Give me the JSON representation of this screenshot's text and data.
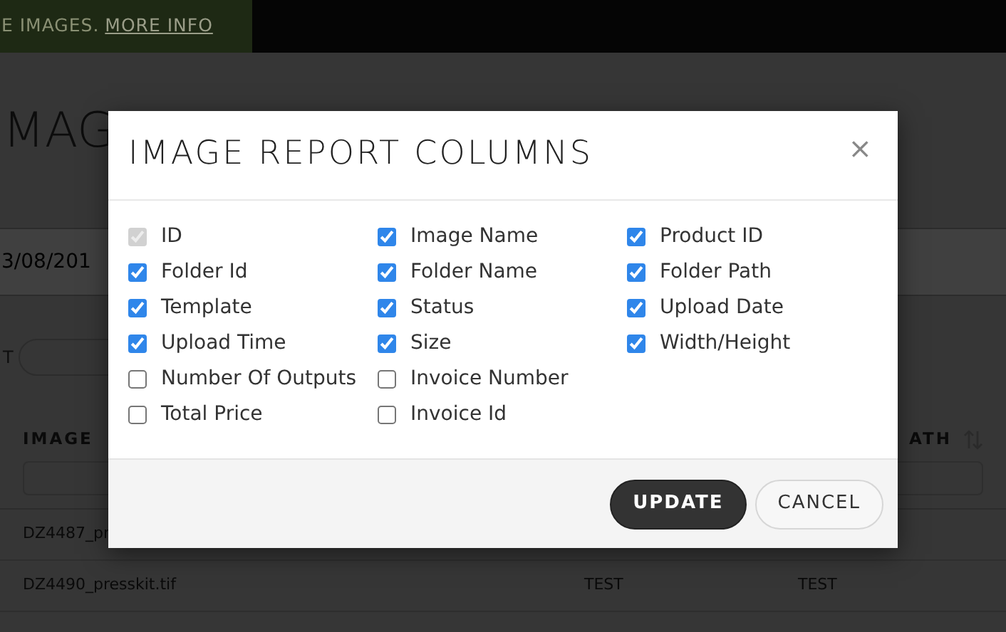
{
  "banner": {
    "text": "E IMAGES.",
    "link": "MORE INFO"
  },
  "page": {
    "title": "MAG",
    "date": "3/08/201",
    "filter_label": "T",
    "columns": [
      {
        "label": "IMAGE"
      },
      {
        "label": "ATH"
      }
    ],
    "rows": [
      [
        "DZ4487_pr"
      ],
      [
        "DZ4490_presskit.tif",
        "TEST",
        "TEST"
      ]
    ]
  },
  "modal": {
    "title": "IMAGE REPORT COLUMNS",
    "close": "×",
    "columns": [
      [
        {
          "label": "ID",
          "checked": true,
          "disabled": true
        },
        {
          "label": "Folder Id",
          "checked": true,
          "disabled": false
        },
        {
          "label": "Template",
          "checked": true,
          "disabled": false
        },
        {
          "label": "Upload Time",
          "checked": true,
          "disabled": false
        },
        {
          "label": "Number Of Outputs",
          "checked": false,
          "disabled": false
        },
        {
          "label": "Total Price",
          "checked": false,
          "disabled": false
        }
      ],
      [
        {
          "label": "Image Name",
          "checked": true,
          "disabled": false
        },
        {
          "label": "Folder Name",
          "checked": true,
          "disabled": false
        },
        {
          "label": "Status",
          "checked": true,
          "disabled": false
        },
        {
          "label": "Size",
          "checked": true,
          "disabled": false
        },
        {
          "label": "Invoice Number",
          "checked": false,
          "disabled": false
        },
        {
          "label": "Invoice Id",
          "checked": false,
          "disabled": false
        }
      ],
      [
        {
          "label": "Product ID",
          "checked": true,
          "disabled": false
        },
        {
          "label": "Folder Path",
          "checked": true,
          "disabled": false
        },
        {
          "label": "Upload Date",
          "checked": true,
          "disabled": false
        },
        {
          "label": "Width/Height",
          "checked": true,
          "disabled": false
        }
      ]
    ],
    "buttons": [
      {
        "label": "UPDATE",
        "kind": "primary"
      },
      {
        "label": "CANCEL",
        "kind": "secondary"
      }
    ]
  }
}
